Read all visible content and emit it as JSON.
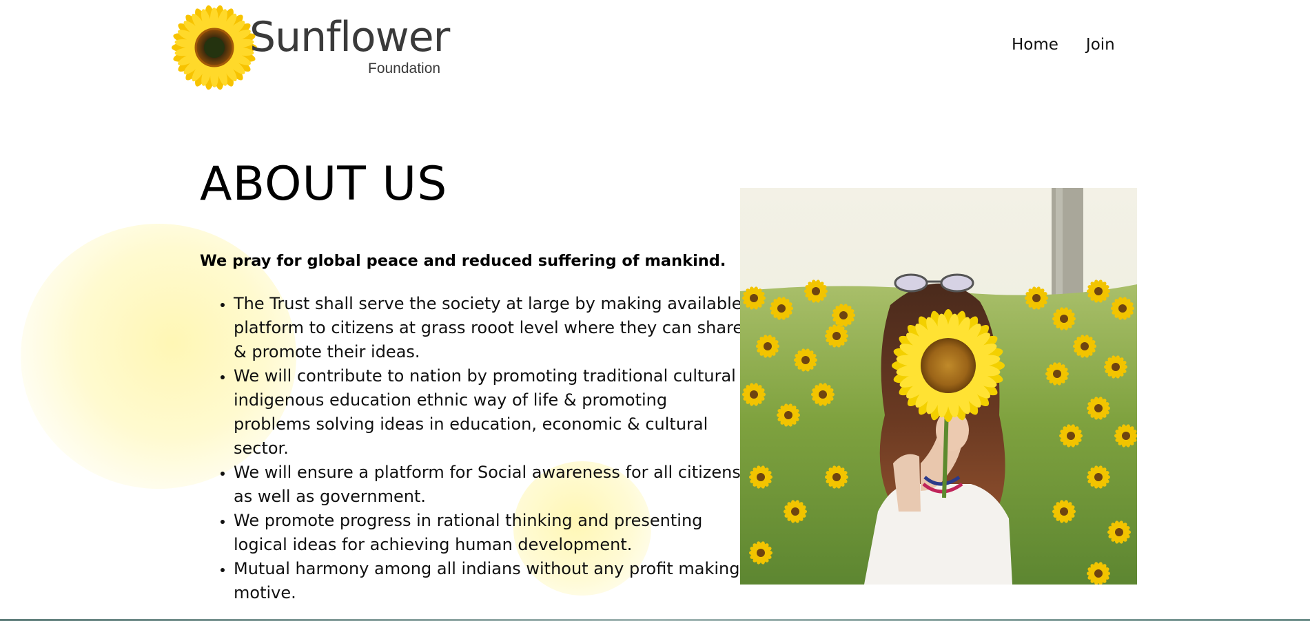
{
  "header": {
    "logo_word": "Sunflower",
    "logo_sub": "Foundation",
    "nav": [
      {
        "label": "Home"
      },
      {
        "label": "Join"
      }
    ]
  },
  "main": {
    "title": "ABOUT US",
    "lead": "We pray for global peace and reduced suffering of mankind.",
    "points": [
      "The Trust shall serve the society at large by making available platform to citizens at grass rooot level where they can share & promote their ideas.",
      "We will contribute to nation by promoting traditional cultural indigenous education ethnic way of life & promoting problems solving ideas in education, economic & cultural sector.",
      "We will ensure a platform for Social awareness for all citizens as well as government.",
      "We promote progress in rational thinking and presenting logical ideas for achieving human development.",
      "Mutual harmony among all indians without any profit making motive."
    ]
  },
  "colors": {
    "accent_yellow": "#FFE94A",
    "text": "#111111",
    "logo_text": "#3A3A3A"
  },
  "icons": {
    "logo": "sunflower-logo-icon",
    "photo": "girl-holding-sunflower-photo"
  }
}
